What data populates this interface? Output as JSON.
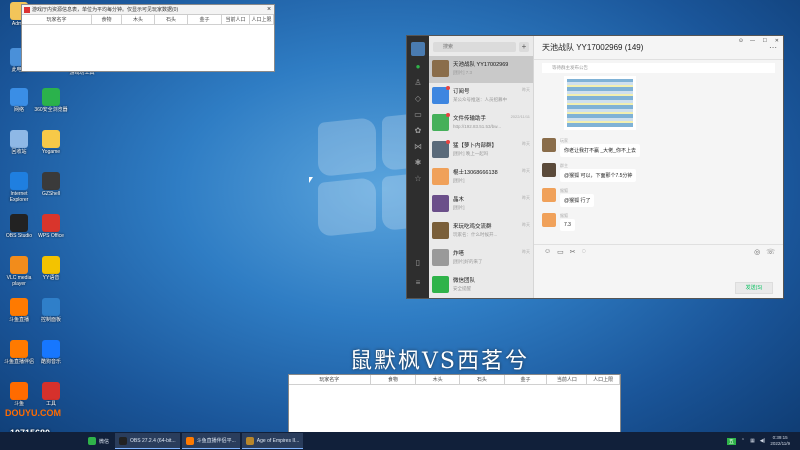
{
  "desktop": {
    "icons": [
      {
        "label": "Admin",
        "icon": "user-folder-icon",
        "color": "#f2c55a"
      },
      {
        "label": "此电脑",
        "icon": "computer-icon",
        "color": "#4a90d9"
      },
      {
        "label": "网络",
        "icon": "network-icon",
        "color": "#3a8ee6"
      },
      {
        "label": "360安全浏览器",
        "icon": "360-browser-icon",
        "color": "#2bb24c"
      },
      {
        "label": "回收站",
        "icon": "recycle-bin-icon",
        "color": "#8eb8e6"
      },
      {
        "label": "Yogame",
        "icon": "yogame-icon",
        "color": "#f7c948"
      },
      {
        "label": "Internet Explorer",
        "icon": "ie-icon",
        "color": "#1f7fe0"
      },
      {
        "label": "GZShell",
        "icon": "gzshell-icon",
        "color": "#3a3a3a"
      },
      {
        "label": "OBS Studio",
        "icon": "obs-icon",
        "color": "#222222"
      },
      {
        "label": "WPS Office",
        "icon": "wps-icon",
        "color": "#d9352c"
      },
      {
        "label": "VLC media player",
        "icon": "vlc-icon",
        "color": "#f28c1b"
      },
      {
        "label": "YY语音",
        "icon": "yy-icon",
        "color": "#f3c300"
      },
      {
        "label": "斗鱼直播",
        "icon": "douyu-live-icon",
        "color": "#ff7a00"
      },
      {
        "label": "控制面板",
        "icon": "control-panel-icon",
        "color": "#2f7fc9"
      },
      {
        "label": "斗鱼直播伴侣",
        "icon": "douyu-companion-icon",
        "color": "#ff7a00"
      },
      {
        "label": "酷狗音乐",
        "icon": "kugou-icon",
        "color": "#1677ff"
      },
      {
        "label": "斗鱼",
        "icon": "douyu-icon",
        "color": "#ff6b00"
      },
      {
        "label": "工具",
        "icon": "tools-icon",
        "color": "#d6312c"
      }
    ],
    "extra_icon_label": "游戏坊工具"
  },
  "small_window": {
    "title": "游戏厅内资源信息表，单位为平均每分钟。仅显示可见玩家数据(0)",
    "close": "×",
    "columns": [
      "玩家名字",
      "食物",
      "木头",
      "石头",
      "金子",
      "当前人口",
      "人口上限"
    ]
  },
  "chat": {
    "search_placeholder": "搜索",
    "plus": "+",
    "header_title": "天池战队 YY17002969 (149)",
    "notice": "等待群主发布公告",
    "conversations": [
      {
        "name": "天池战队 YY17002969",
        "preview": "[图片] 7.3",
        "time": "",
        "color": "#8a6d4a"
      },
      {
        "name": "订阅号",
        "preview": "某公众号推送：人员招募中",
        "time": "昨天",
        "color": "#3e86e0"
      },
      {
        "name": "文件传输助手",
        "preview": "http://192.83.51.53/bw...",
        "time": "2022/11/11",
        "color": "#45b05a"
      },
      {
        "name": "猛【萝卜内部群】",
        "preview": "[图片] 晚上一起吗",
        "time": "昨天",
        "color": "#5a6a7a"
      },
      {
        "name": "棍士13068666138",
        "preview": "[图片]",
        "time": "昨天",
        "color": "#f0a15a"
      },
      {
        "name": "晶木",
        "preview": "[图片]",
        "time": "昨天",
        "color": "#6b4f8a"
      },
      {
        "name": "来玩吃鸡交流群",
        "preview": "玩家名：什么时候开...",
        "time": "昨天",
        "color": "#7a5f3a"
      },
      {
        "name": "炸嗒",
        "preview": "[图片]好的来了",
        "time": "昨天",
        "color": "#9a9a9a"
      },
      {
        "name": "微信团队",
        "preview": "安全提醒",
        "time": "",
        "color": "#2fb34a"
      }
    ],
    "messages": [
      {
        "who": "玩家",
        "text": "你老让我打不赢 _大佬_你不上去"
      },
      {
        "who": "群主",
        "text": "@猴狐 可以，下面那个7.5分钟"
      },
      {
        "who": "猴狐",
        "text": "@猴狐 行了"
      },
      {
        "who": "猴狐",
        "text": "7.3"
      }
    ],
    "send_label": "发送(S)"
  },
  "banner": "鼠默枫VS西茗兮",
  "big_window": {
    "columns": [
      "玩家名字",
      "食物",
      "木头",
      "石头",
      "金子",
      "当前人口",
      "人口上限"
    ]
  },
  "overlay": {
    "brand": "DOUYU.COM",
    "viewer_count": "10715680"
  },
  "taskbar": {
    "apps": [
      {
        "label": "微信",
        "icon": "wechat-icon",
        "color": "#2fb34a"
      },
      {
        "label": "OBS 27.2.4 (64-bit...",
        "icon": "obs-icon",
        "color": "#222222"
      },
      {
        "label": "斗鱼直播伴侣平...",
        "icon": "douyu-icon",
        "color": "#ff7a00"
      },
      {
        "label": "Age of Empires II...",
        "icon": "aoe-icon",
        "color": "#b8862b"
      }
    ],
    "clock_time": "0:39:15",
    "clock_date": "2022/11/9",
    "ime": "五"
  }
}
